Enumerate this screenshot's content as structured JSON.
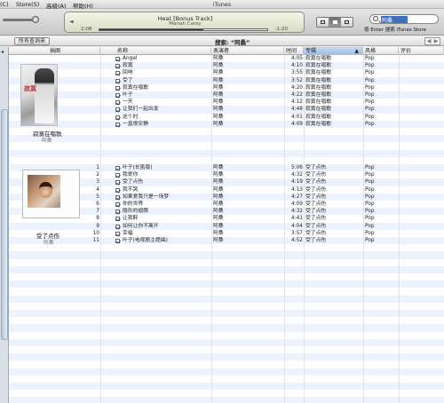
{
  "menu": [
    "(C)",
    "Store(S)",
    "高级(A)",
    "帮助(H)"
  ],
  "window_title": "iTunes",
  "now_playing": {
    "title": "Heat [Bonus Track]",
    "artist": "Mariah Carey",
    "elapsed": "2:08",
    "remaining": "-1:20",
    "progress": 0.62
  },
  "search": {
    "value": "阿桑",
    "hint": "按 Enter 搜索 iTunes Store"
  },
  "subbar": {
    "all_button": "所有查询来",
    "search_label": "搜索: “阿桑”",
    "back": "◀",
    "forward": "▶"
  },
  "columns": [
    "插图",
    "名称",
    "表演者",
    "时间",
    "专辑",
    "风格",
    "评价"
  ],
  "album1": {
    "title": "寂寞在唱歌",
    "artist": "阿桑",
    "cover_mark": "寂寞"
  },
  "album2": {
    "title": "受了点伤",
    "artist": "阿桑",
    "dots": "· · · · ·"
  },
  "tracks_album1": [
    {
      "num": "",
      "name": "Angel",
      "artist": "阿桑",
      "time": "4:05",
      "album": "寂寞在唱歌",
      "genre": "Pop"
    },
    {
      "num": "",
      "name": "寂寞",
      "artist": "阿桑",
      "time": "4:10",
      "album": "寂寞在唱歌",
      "genre": "Pop"
    },
    {
      "num": "",
      "name": "回响",
      "artist": "阿桑",
      "time": "3:55",
      "album": "寂寞在唱歌",
      "genre": "Pop"
    },
    {
      "num": "",
      "name": "受了",
      "artist": "阿桑",
      "time": "3:52",
      "album": "寂寞在唱歌",
      "genre": "Pop"
    },
    {
      "num": "",
      "name": "寂寞在唱歌",
      "artist": "阿桑",
      "time": "4:20",
      "album": "寂寞在唱歌",
      "genre": "Pop"
    },
    {
      "num": "",
      "name": "叶子",
      "artist": "阿桑",
      "time": "4:22",
      "album": "寂寞在唱歌",
      "genre": "Pop"
    },
    {
      "num": "",
      "name": "一天",
      "artist": "阿桑",
      "time": "4:12",
      "album": "寂寞在唱歌",
      "genre": "Pop"
    },
    {
      "num": "",
      "name": "让我们一起出发",
      "artist": "阿桑",
      "time": "4:48",
      "album": "寂寞在唱歌",
      "genre": "Pop"
    },
    {
      "num": "",
      "name": "这个时",
      "artist": "阿桑",
      "time": "4:01",
      "album": "寂寞在唱歌",
      "genre": "Pop"
    },
    {
      "num": "",
      "name": "一直很安静",
      "artist": "阿桑",
      "time": "4:09",
      "album": "寂寞在唱歌",
      "genre": "Pop"
    }
  ],
  "tracks_album2": [
    {
      "num": "1",
      "name": "叶子(长笛版)",
      "artist": "阿桑",
      "time": "5:06",
      "album": "受了点伤",
      "genre": "Pop"
    },
    {
      "num": "2",
      "name": "我爱你",
      "artist": "阿桑",
      "time": "4:32",
      "album": "受了点伤",
      "genre": "Pop"
    },
    {
      "num": "3",
      "name": "受了点伤",
      "artist": "阿桑",
      "time": "4:19",
      "album": "受了点伤",
      "genre": "Pop"
    },
    {
      "num": "4",
      "name": "我不哭",
      "artist": "阿桑",
      "time": "4:13",
      "album": "受了点伤",
      "genre": "Pop"
    },
    {
      "num": "5",
      "name": "如果爱我只是一场梦",
      "artist": "阿桑",
      "time": "4:27",
      "album": "受了点伤",
      "genre": "Pop"
    },
    {
      "num": "6",
      "name": "你的世界",
      "artist": "阿桑",
      "time": "4:09",
      "album": "受了点伤",
      "genre": "Pop"
    },
    {
      "num": "7",
      "name": "隐形的翅膀",
      "artist": "阿桑",
      "time": "4:32",
      "album": "受了点伤",
      "genre": "Pop"
    },
    {
      "num": "8",
      "name": "让我醉",
      "artist": "阿桑",
      "time": "4:41",
      "album": "受了点伤",
      "genre": "Pop"
    },
    {
      "num": "9",
      "name": "如何让你不离开",
      "artist": "阿桑",
      "time": "4:04",
      "album": "受了点伤",
      "genre": "Pop"
    },
    {
      "num": "10",
      "name": "幸福",
      "artist": "阿桑",
      "time": "3:57",
      "album": "受了点伤",
      "genre": "Pop"
    },
    {
      "num": "11",
      "name": "叶子(电视剧主题曲)",
      "artist": "阿桑",
      "time": "4:52",
      "album": "受了点伤",
      "genre": "Pop"
    }
  ]
}
